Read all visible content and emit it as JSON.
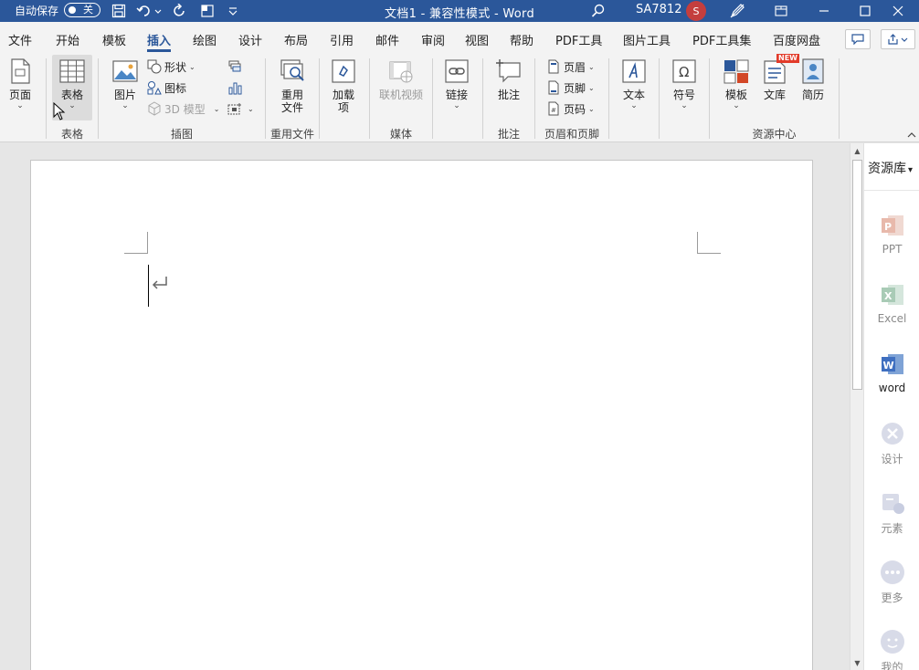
{
  "titlebar": {
    "autosave_label": "自动保存",
    "autosave_state": "关",
    "title": "文档1 - 兼容性模式 - Word",
    "user": "SA7812",
    "avatar_initial": "S"
  },
  "tabs": [
    "文件",
    "开始",
    "模板",
    "插入",
    "绘图",
    "设计",
    "布局",
    "引用",
    "邮件",
    "审阅",
    "视图",
    "帮助",
    "PDF工具",
    "图片工具",
    "PDF工具集",
    "百度网盘"
  ],
  "active_tab": "插入",
  "ribbon": {
    "page": {
      "label": "页面"
    },
    "table": {
      "label": "表格",
      "group": "表格"
    },
    "picture": {
      "label": "图片"
    },
    "shapes": {
      "label": "形状"
    },
    "icons": {
      "label": "图标"
    },
    "model3d": {
      "label": "3D 模型"
    },
    "illustrations_group": "插图",
    "reuse": {
      "label1": "重用",
      "label2": "文件",
      "group": "重用文件"
    },
    "addins": {
      "label1": "加载",
      "label2": "项"
    },
    "video": {
      "label": "联机视频",
      "group": "媒体"
    },
    "link": {
      "label": "链接"
    },
    "comment": {
      "label": "批注",
      "group": "批注"
    },
    "header": {
      "label": "页眉"
    },
    "footer": {
      "label": "页脚"
    },
    "pagenum": {
      "label": "页码"
    },
    "hf_group": "页眉和页脚",
    "text": {
      "label": "文本"
    },
    "symbol": {
      "label": "符号"
    },
    "template": {
      "label": "模板"
    },
    "library": {
      "label": "文库",
      "badge": "NEW"
    },
    "resume": {
      "label": "简历"
    },
    "resource_group": "资源中心"
  },
  "sidepanel": {
    "title": "资源库",
    "items": [
      {
        "label": "PPT",
        "icon": "ppt-icon"
      },
      {
        "label": "Excel",
        "icon": "excel-icon"
      },
      {
        "label": "word",
        "icon": "word-icon"
      },
      {
        "label": "设计",
        "icon": "design-icon"
      },
      {
        "label": "元素",
        "icon": "element-icon"
      },
      {
        "label": "更多",
        "icon": "more-icon"
      },
      {
        "label": "我的",
        "icon": "mine-icon"
      }
    ]
  },
  "colors": {
    "brand": "#2b579a",
    "ppt": "#d24726",
    "excel": "#1d6f42",
    "word": "#2b579a"
  }
}
